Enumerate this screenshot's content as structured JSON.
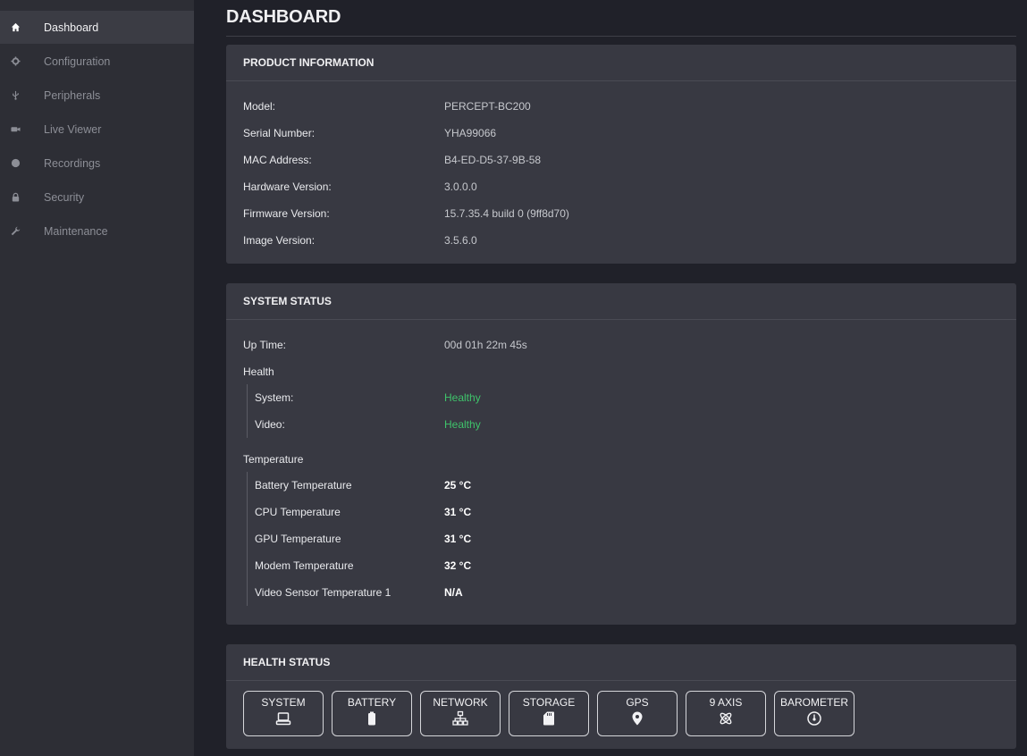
{
  "sidebar": {
    "items": [
      {
        "label": "Dashboard",
        "icon": "home-icon"
      },
      {
        "label": "Configuration",
        "icon": "gear-icon"
      },
      {
        "label": "Peripherals",
        "icon": "usb-icon"
      },
      {
        "label": "Live Viewer",
        "icon": "video-camera-icon"
      },
      {
        "label": "Recordings",
        "icon": "record-dot-icon"
      },
      {
        "label": "Security",
        "icon": "lock-icon"
      },
      {
        "label": "Maintenance",
        "icon": "wrench-icon"
      }
    ]
  },
  "page": {
    "title": "DASHBOARD"
  },
  "product": {
    "title": "PRODUCT INFORMATION",
    "rows": [
      {
        "label": "Model:",
        "value": "PERCEPT-BC200"
      },
      {
        "label": "Serial Number:",
        "value": "YHA99066"
      },
      {
        "label": "MAC Address:",
        "value": "B4-ED-D5-37-9B-58"
      },
      {
        "label": "Hardware Version:",
        "value": "3.0.0.0"
      },
      {
        "label": "Firmware Version:",
        "value": "15.7.35.4 build 0 (9ff8d70)"
      },
      {
        "label": "Image Version:",
        "value": "3.5.6.0"
      }
    ]
  },
  "system": {
    "title": "SYSTEM STATUS",
    "uptime_label": "Up Time:",
    "uptime_value": "00d 01h 22m 45s",
    "health_label": "Health",
    "health": [
      {
        "label": "System:",
        "value": "Healthy"
      },
      {
        "label": "Video:",
        "value": "Healthy"
      }
    ],
    "temperature_label": "Temperature",
    "temperatures": [
      {
        "label": "Battery Temperature",
        "value": "25 °C"
      },
      {
        "label": "CPU Temperature",
        "value": "31 °C"
      },
      {
        "label": "GPU Temperature",
        "value": "31 °C"
      },
      {
        "label": "Modem Temperature",
        "value": "32 °C"
      },
      {
        "label": "Video Sensor Temperature 1",
        "value": "N/A"
      }
    ]
  },
  "health_status": {
    "title": "HEALTH STATUS",
    "buttons": [
      {
        "label": "SYSTEM",
        "icon": "laptop-icon"
      },
      {
        "label": "BATTERY",
        "icon": "battery-icon"
      },
      {
        "label": "NETWORK",
        "icon": "network-icon"
      },
      {
        "label": "STORAGE",
        "icon": "sd-card-icon"
      },
      {
        "label": "GPS",
        "icon": "map-pin-icon"
      },
      {
        "label": "9 AXIS",
        "icon": "axis-icon"
      },
      {
        "label": "BAROMETER",
        "icon": "gauge-icon"
      }
    ]
  },
  "colors": {
    "healthy": "#3fc46b",
    "background": "#202129",
    "card": "#383942",
    "sidebar": "#2d2e35"
  }
}
